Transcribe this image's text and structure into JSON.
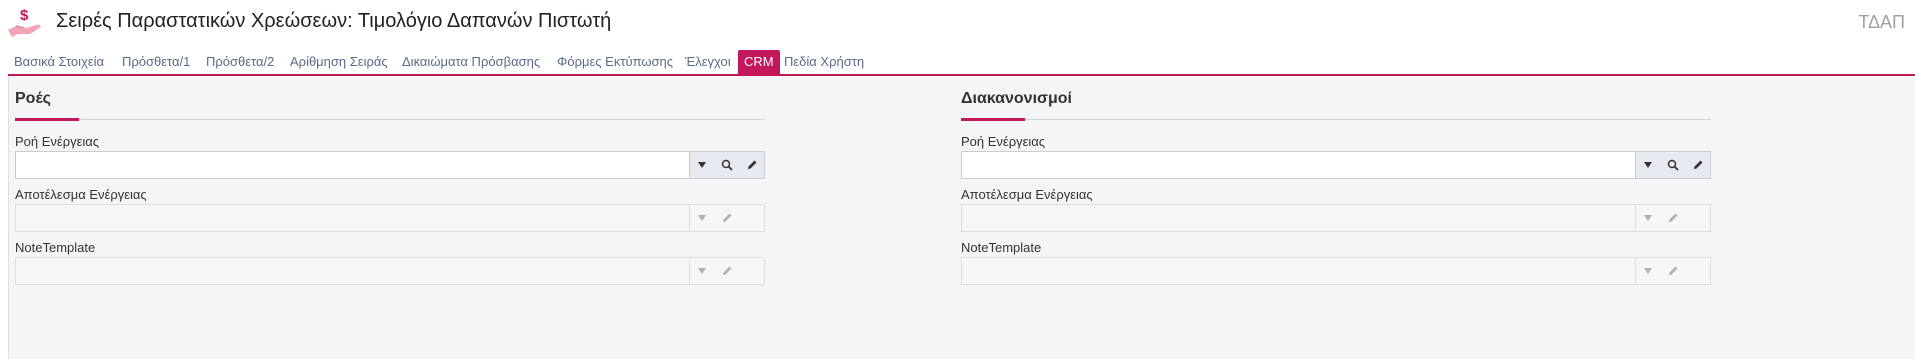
{
  "header": {
    "title": "Σειρές Παραστατικών Χρεώσεων: Τιμολόγιο Δαπανών Πιστωτή",
    "series_code": "ΤΔΑΠ",
    "icon": "hand-dollar-icon"
  },
  "tabs": [
    {
      "label": "Βασικά Στοιχεία",
      "active": false
    },
    {
      "label": "Πρόσθετα/1",
      "active": false
    },
    {
      "label": "Πρόσθετα/2",
      "active": false
    },
    {
      "label": "Αρίθμηση Σειράς",
      "active": false
    },
    {
      "label": "Δικαιώματα Πρόσβασης",
      "active": false
    },
    {
      "label": "Φόρμες Εκτύπωσης",
      "active": false
    },
    {
      "label": "Έλεγχοι",
      "active": false
    },
    {
      "label": "CRM",
      "active": true
    },
    {
      "label": "Πεδία Χρήστη",
      "active": false
    }
  ],
  "sections": [
    {
      "title": "Ροές",
      "fields": [
        {
          "label": "Ροή Ενέργειας",
          "value": "",
          "enabled": true
        },
        {
          "label": "Αποτέλεσμα Ενέργειας",
          "value": "",
          "enabled": false
        },
        {
          "label": "NoteTemplate",
          "value": "",
          "enabled": false
        }
      ]
    },
    {
      "title": "Διακανονισμοί",
      "fields": [
        {
          "label": "Ροή Ενέργειας",
          "value": "",
          "enabled": true
        },
        {
          "label": "Αποτέλεσμα Ενέργειας",
          "value": "",
          "enabled": false
        },
        {
          "label": "NoteTemplate",
          "value": "",
          "enabled": false
        }
      ]
    }
  ],
  "colors": {
    "accent": "#c2185b",
    "tab_text": "#5a6b88",
    "panel_bg": "#f3f5f6"
  },
  "field_button_icons": [
    "dropdown-arrow-icon",
    "search-icon",
    "edit-pencil-icon"
  ]
}
